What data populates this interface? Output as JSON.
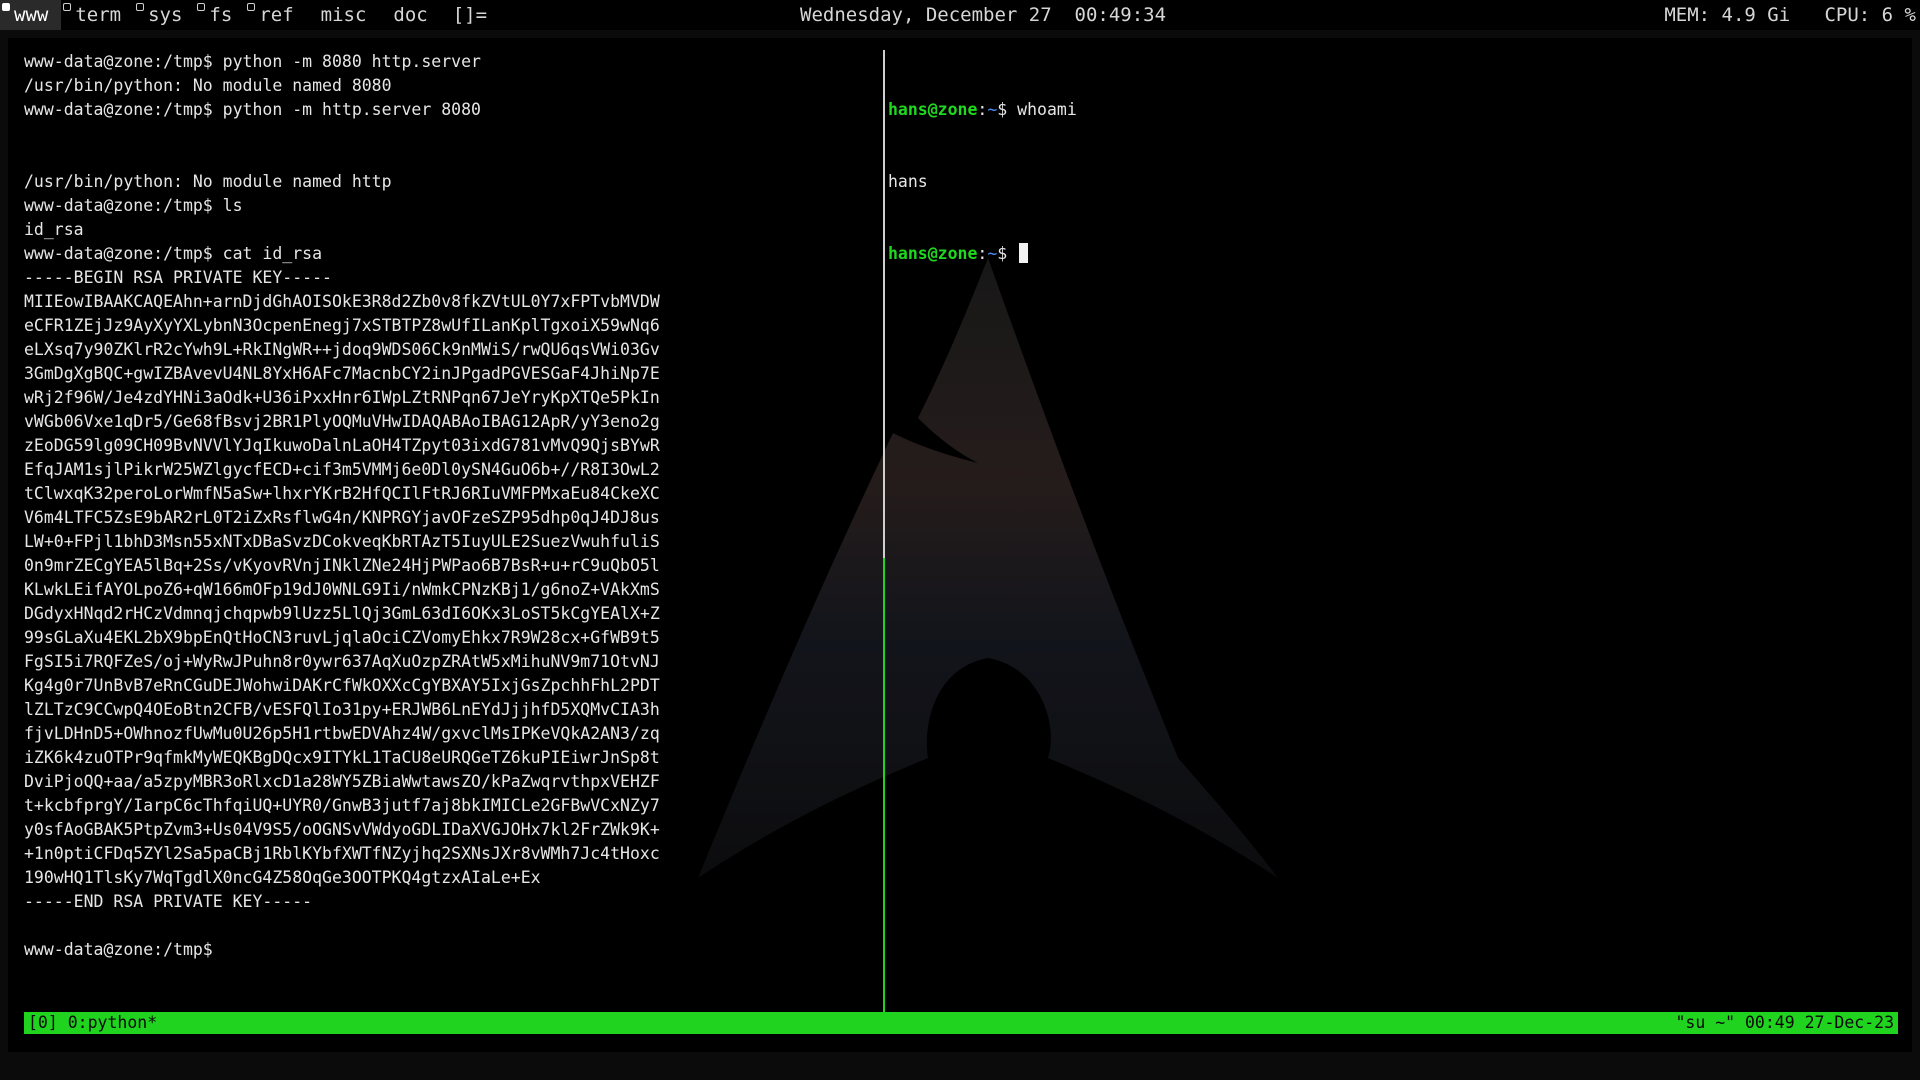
{
  "topbar": {
    "workspaces": [
      {
        "label": "www",
        "active": true,
        "has_dot": true
      },
      {
        "label": "term",
        "active": false,
        "has_dot": true
      },
      {
        "label": "sys",
        "active": false,
        "has_dot": true
      },
      {
        "label": "fs",
        "active": false,
        "has_dot": true
      },
      {
        "label": "ref",
        "active": false,
        "has_dot": true
      },
      {
        "label": "misc",
        "active": false,
        "has_dot": false
      },
      {
        "label": "doc",
        "active": false,
        "has_dot": false
      }
    ],
    "layout_indicator": "[]=",
    "clock": "Wednesday, December 27  00:49:34",
    "stats": "MEM: 4.9 Gi   CPU: 6 %"
  },
  "left_pane": {
    "lines": [
      "www-data@zone:/tmp$ python -m 8080 http.server",
      "/usr/bin/python: No module named 8080",
      "www-data@zone:/tmp$ python -m http.server 8080",
      "",
      "",
      "/usr/bin/python: No module named http",
      "www-data@zone:/tmp$ ls",
      "id_rsa",
      "www-data@zone:/tmp$ cat id_rsa",
      "-----BEGIN RSA PRIVATE KEY-----",
      "MIIEowIBAAKCAQEAhn+arnDjdGhAOISOkE3R8d2Zb0v8fkZVtUL0Y7xFPTvbMVDW",
      "eCFR1ZEjJz9AyXyYXLybnN3OcpenEnegj7xSTBTPZ8wUfILanKplTgxoiX59wNq6",
      "eLXsq7y90ZKlrR2cYwh9L+RkINgWR++jdoq9WDS06Ck9nMWiS/rwQU6qsVWi03Gv",
      "3GmDgXgBQC+gwIZBAvevU4NL8YxH6AFc7MacnbCY2inJPgadPGVESGaF4JhiNp7E",
      "wRj2f96W/Je4zdYHNi3aOdk+U36iPxxHnr6IWpLZtRNPqn67JeYryKpXTQe5PkIn",
      "vWGb06Vxe1qDr5/Ge68fBsvj2BR1PlyOQMuVHwIDAQABAoIBAG12ApR/yY3eno2g",
      "zEoDG59lg09CH09BvNVVlYJqIkuwoDalnLaOH4TZpyt03ixdG781vMvQ9QjsBYwR",
      "EfqJAM1sjlPikrW25WZlgycfECD+cif3m5VMMj6e0Dl0ySN4GuO6b+//R8I3OwL2",
      "tClwxqK32peroLorWmfN5aSw+lhxrYKrB2HfQCIlFtRJ6RIuVMFPMxaEu84CkeXC",
      "V6m4LTFC5ZsE9bAR2rL0T2iZxRsflwG4n/KNPRGYjavOFzeSZP95dhp0qJ4DJ8us",
      "LW+0+FPjl1bhD3Msn55xNTxDBaSvzDCokveqKbRTAzT5IuyULE2SuezVwuhfuliS",
      "0n9mrZECgYEA5lBq+2Ss/vKyovRVnjINklZNe24HjPWPao6B7BsR+u+rC9uQbO5l",
      "KLwkLEifAYOLpoZ6+qW166mOFp19dJ0WNLG9Ii/nWmkCPNzKBj1/g6noZ+VAkXmS",
      "DGdyxHNqd2rHCzVdmnqjchqpwb9lUzz5LlQj3GmL63dI6OKx3LoST5kCgYEAlX+Z",
      "99sGLaXu4EKL2bX9bpEnQtHoCN3ruvLjqlaOciCZVomyEhkx7R9W28cx+GfWB9t5",
      "FgSI5i7RQFZeS/oj+WyRwJPuhn8r0ywr637AqXuOzpZRAtW5xMihuNV9m71OtvNJ",
      "Kg4g0r7UnBvB7eRnCGuDEJWohwiDAKrCfWkOXXcCgYBXAY5IxjGsZpchhFhL2PDT",
      "lZLTzC9CCwpQ4OEoBtn2CFB/vESFQlIo31py+ERJWB6LnEYdJjjhfD5XQMvCIA3h",
      "fjvLDHnD5+OWhnozfUwMu0U26p5H1rtbwEDVAhz4W/gxvclMsIPKeVQkA2AN3/zq",
      "iZK6k4zuOTPr9qfmkMyWEQKBgDQcx9ITYkL1TaCU8eURQGeTZ6kuPIEiwrJnSp8t",
      "DviPjoQQ+aa/a5zpyMBR3oRlxcD1a28WY5ZBiaWwtawsZO/kPaZwqrvthpxVEHZF",
      "t+kcbfprgY/IarpC6cThfqiUQ+UYR0/GnwB3jutf7aj8bkIMICLe2GFBwVCxNZy7",
      "y0sfAoGBAK5PtpZvm3+Us04V9S5/oOGNSvVWdyoGDLIDaXVGJOHx7kl2FrZWk9K+",
      "+1n0ptiCFDq5ZYl2Sa5paCBj1RblKYbfXWTfNZyjhq2SXNsJXr8vWMh7Jc4tHoxc",
      "190wHQ1TlsKy7WqTgdlX0ncG4Z58OqGe3OOTPKQ4gtzxAIaLe+Ex",
      "-----END RSA PRIVATE KEY-----",
      "",
      "www-data@zone:/tmp$"
    ]
  },
  "right_pane": {
    "prompt_user": "hans@zone",
    "prompt_sep": ":",
    "prompt_path": "~",
    "prompt_symbol": "$",
    "command": " whoami",
    "output": "hans"
  },
  "status_bar": {
    "left": "[0] 0:python*",
    "right": "\"su ~\" 00:49 27-Dec-23"
  },
  "colors": {
    "status_green": "#1fd31f",
    "prompt_user": "#20d820",
    "prompt_path": "#4d8cff",
    "background": "#000000"
  }
}
